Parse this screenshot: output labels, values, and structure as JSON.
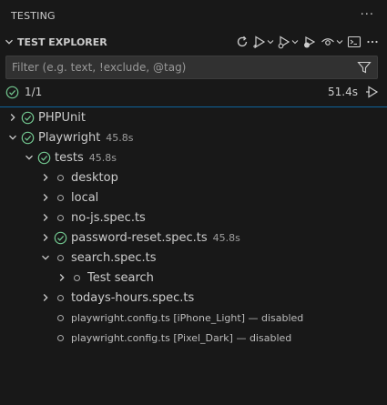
{
  "panel": {
    "title": "TESTING",
    "more_label": "···"
  },
  "section": {
    "title": "TEST EXPLORER",
    "toolbar": [
      {
        "name": "refresh-tests-icon"
      },
      {
        "name": "run-tests-icon"
      },
      {
        "name": "debug-tests-icon"
      },
      {
        "name": "coverage-icon"
      },
      {
        "name": "view-eye-icon"
      },
      {
        "name": "terminal-output-icon"
      },
      {
        "name": "more-actions-icon"
      }
    ]
  },
  "filter": {
    "placeholder": "Filter (e.g. text, !exclude, @tag)",
    "value": ""
  },
  "summary": {
    "count": "1/1",
    "duration": "51.4s"
  },
  "colors": {
    "passed": "#73c991",
    "progress": "#0e639c",
    "background": "#181818"
  },
  "tree": [
    {
      "label": "PHPUnit",
      "duration": "",
      "level": 0,
      "expander": "collapsed",
      "status": "passed"
    },
    {
      "label": "Playwright",
      "duration": "45.8s",
      "level": 0,
      "expander": "expanded",
      "status": "passed"
    },
    {
      "label": "tests",
      "duration": "45.8s",
      "level": 1,
      "expander": "expanded",
      "status": "passed"
    },
    {
      "label": "desktop",
      "duration": "",
      "level": 2,
      "expander": "collapsed",
      "status": "unset"
    },
    {
      "label": "local",
      "duration": "",
      "level": 2,
      "expander": "collapsed",
      "status": "unset"
    },
    {
      "label": "no-js.spec.ts",
      "duration": "",
      "level": 2,
      "expander": "collapsed",
      "status": "unset"
    },
    {
      "label": "password-reset.spec.ts",
      "duration": "45.8s",
      "level": 2,
      "expander": "collapsed",
      "status": "passed"
    },
    {
      "label": "search.spec.ts",
      "duration": "",
      "level": 2,
      "expander": "expanded",
      "status": "unset"
    },
    {
      "label": "Test search",
      "duration": "",
      "level": 3,
      "expander": "collapsed",
      "status": "unset"
    },
    {
      "label": "todays-hours.spec.ts",
      "duration": "",
      "level": 2,
      "expander": "collapsed",
      "status": "unset"
    },
    {
      "label": "playwright.config.ts [iPhone_Light] — disabled",
      "duration": "",
      "level": 2,
      "expander": "none",
      "status": "unset",
      "dim": true
    },
    {
      "label": "playwright.config.ts [Pixel_Dark] — disabled",
      "duration": "",
      "level": 2,
      "expander": "none",
      "status": "unset",
      "dim": true
    }
  ]
}
